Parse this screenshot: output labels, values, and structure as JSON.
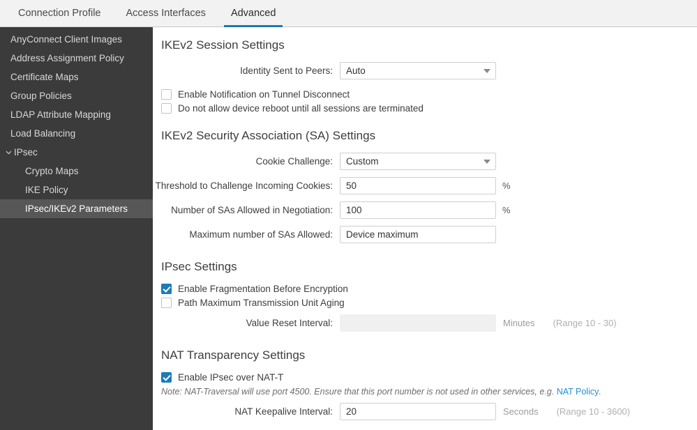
{
  "tabs": [
    {
      "label": "Connection Profile",
      "active": false
    },
    {
      "label": "Access Interfaces",
      "active": false
    },
    {
      "label": "Advanced",
      "active": true
    }
  ],
  "sidebar": {
    "items": [
      {
        "label": "AnyConnect Client Images",
        "level": "top",
        "selected": false,
        "expandable": false
      },
      {
        "label": "Address Assignment Policy",
        "level": "top",
        "selected": false,
        "expandable": false
      },
      {
        "label": "Certificate Maps",
        "level": "top",
        "selected": false,
        "expandable": false
      },
      {
        "label": "Group Policies",
        "level": "top",
        "selected": false,
        "expandable": false
      },
      {
        "label": "LDAP Attribute Mapping",
        "level": "top",
        "selected": false,
        "expandable": false
      },
      {
        "label": "Load Balancing",
        "level": "top",
        "selected": false,
        "expandable": false
      },
      {
        "label": "IPsec",
        "level": "group",
        "selected": false,
        "expandable": true,
        "expanded": true
      },
      {
        "label": "Crypto Maps",
        "level": "child",
        "selected": false,
        "expandable": false
      },
      {
        "label": "IKE Policy",
        "level": "child",
        "selected": false,
        "expandable": false
      },
      {
        "label": "IPsec/IKEv2 Parameters",
        "level": "child",
        "selected": true,
        "expandable": false
      }
    ]
  },
  "sections": {
    "session": {
      "title": "IKEv2 Session Settings",
      "identity_label": "Identity Sent to Peers:",
      "identity_value": "Auto",
      "checkbox_notify": {
        "label": "Enable Notification on Tunnel Disconnect",
        "checked": false
      },
      "checkbox_reboot": {
        "label": "Do not allow device reboot until all sessions are terminated",
        "checked": false
      }
    },
    "sa": {
      "title": "IKEv2 Security Association (SA) Settings",
      "cookie_label": "Cookie Challenge:",
      "cookie_value": "Custom",
      "threshold_label": "Threshold to Challenge Incoming Cookies:",
      "threshold_value": "50",
      "threshold_unit": "%",
      "negotiation_label": "Number of SAs Allowed in Negotiation:",
      "negotiation_value": "100",
      "negotiation_unit": "%",
      "max_label": "Maximum number of SAs Allowed:",
      "max_value": "Device maximum"
    },
    "ipsec": {
      "title": "IPsec Settings",
      "checkbox_frag": {
        "label": "Enable Fragmentation Before Encryption",
        "checked": true
      },
      "checkbox_pmtu": {
        "label": "Path Maximum Transmission Unit Aging",
        "checked": false
      },
      "reset_label": "Value Reset Interval:",
      "reset_value": "",
      "reset_unit": "Minutes",
      "reset_range": "(Range 10 - 30)"
    },
    "nat": {
      "title": "NAT Transparency Settings",
      "checkbox_natt": {
        "label": "Enable IPsec over NAT-T",
        "checked": true
      },
      "note_prefix": "Note: NAT-Traversal will use port 4500. Ensure that this port number is not used in other services, e.g. ",
      "note_link": "NAT Policy",
      "note_suffix": ".",
      "keepalive_label": "NAT Keepalive Interval:",
      "keepalive_value": "20",
      "keepalive_unit": "Seconds",
      "keepalive_range": "(Range 10 - 3600)"
    }
  },
  "colors": {
    "accent": "#1b7ab5",
    "checkbox": "#1a7cb8",
    "link": "#1f8fd6",
    "sidebar_bg": "#3b3b3b",
    "sidebar_selected": "#575757"
  }
}
